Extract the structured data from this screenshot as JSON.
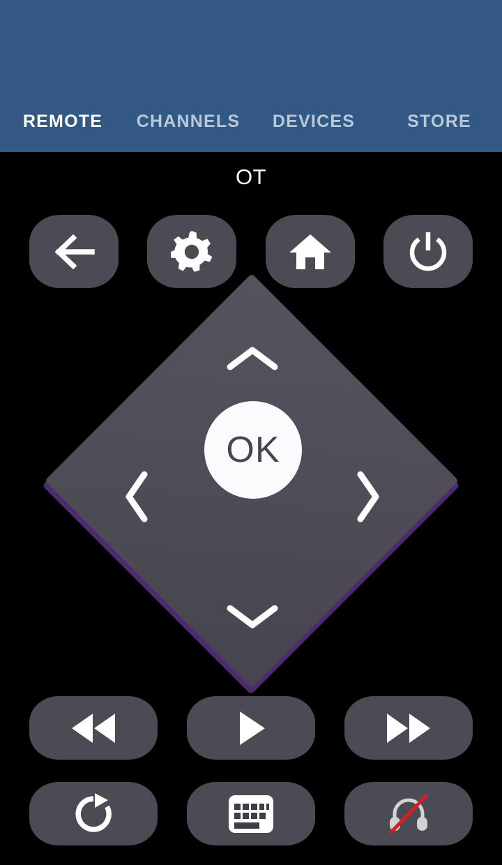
{
  "appbar": {
    "background_color": "#325884",
    "tabs": [
      {
        "label": "REMOTE",
        "name": "tab-remote",
        "active": true
      },
      {
        "label": "CHANNELS",
        "name": "tab-channels",
        "active": false
      },
      {
        "label": "DEVICES",
        "name": "tab-devices",
        "active": false
      },
      {
        "label": "STORE",
        "name": "tab-store",
        "active": false
      }
    ],
    "active_tab_color": "#ffffff",
    "inactive_tab_color": "#b9c8da"
  },
  "device": {
    "name": "OT"
  },
  "top_controls": [
    {
      "icon": "back-arrow-icon",
      "label": "Back"
    },
    {
      "icon": "gear-icon",
      "label": "Options"
    },
    {
      "icon": "home-icon",
      "label": "Home"
    },
    {
      "icon": "power-icon",
      "label": "Power"
    }
  ],
  "dpad": {
    "up_icon": "chevron-up-icon",
    "down_icon": "chevron-down-icon",
    "left_icon": "chevron-left-icon",
    "right_icon": "chevron-right-icon",
    "ok_label": "OK",
    "face_color": "#504d58",
    "shadow_color": "#4b2a6d",
    "ok_background": "#fbfbfd",
    "ok_text_color": "#4a4452"
  },
  "media_controls": {
    "row1": [
      {
        "icon": "rewind-icon",
        "label": "Rewind"
      },
      {
        "icon": "play-icon",
        "label": "Play"
      },
      {
        "icon": "fast-forward-icon",
        "label": "Fast forward"
      }
    ],
    "row2": [
      {
        "icon": "replay-icon",
        "label": "Replay"
      },
      {
        "icon": "keyboard-icon",
        "label": "Keyboard"
      },
      {
        "icon": "headphones-muted-icon",
        "label": "Private listening off"
      }
    ]
  },
  "colors": {
    "screen_background": "#000000",
    "button_fill": "#4b4b53",
    "icon_white": "#ffffff",
    "headphones_gray": "#d3d3d6",
    "slash_red": "#d31f26"
  }
}
